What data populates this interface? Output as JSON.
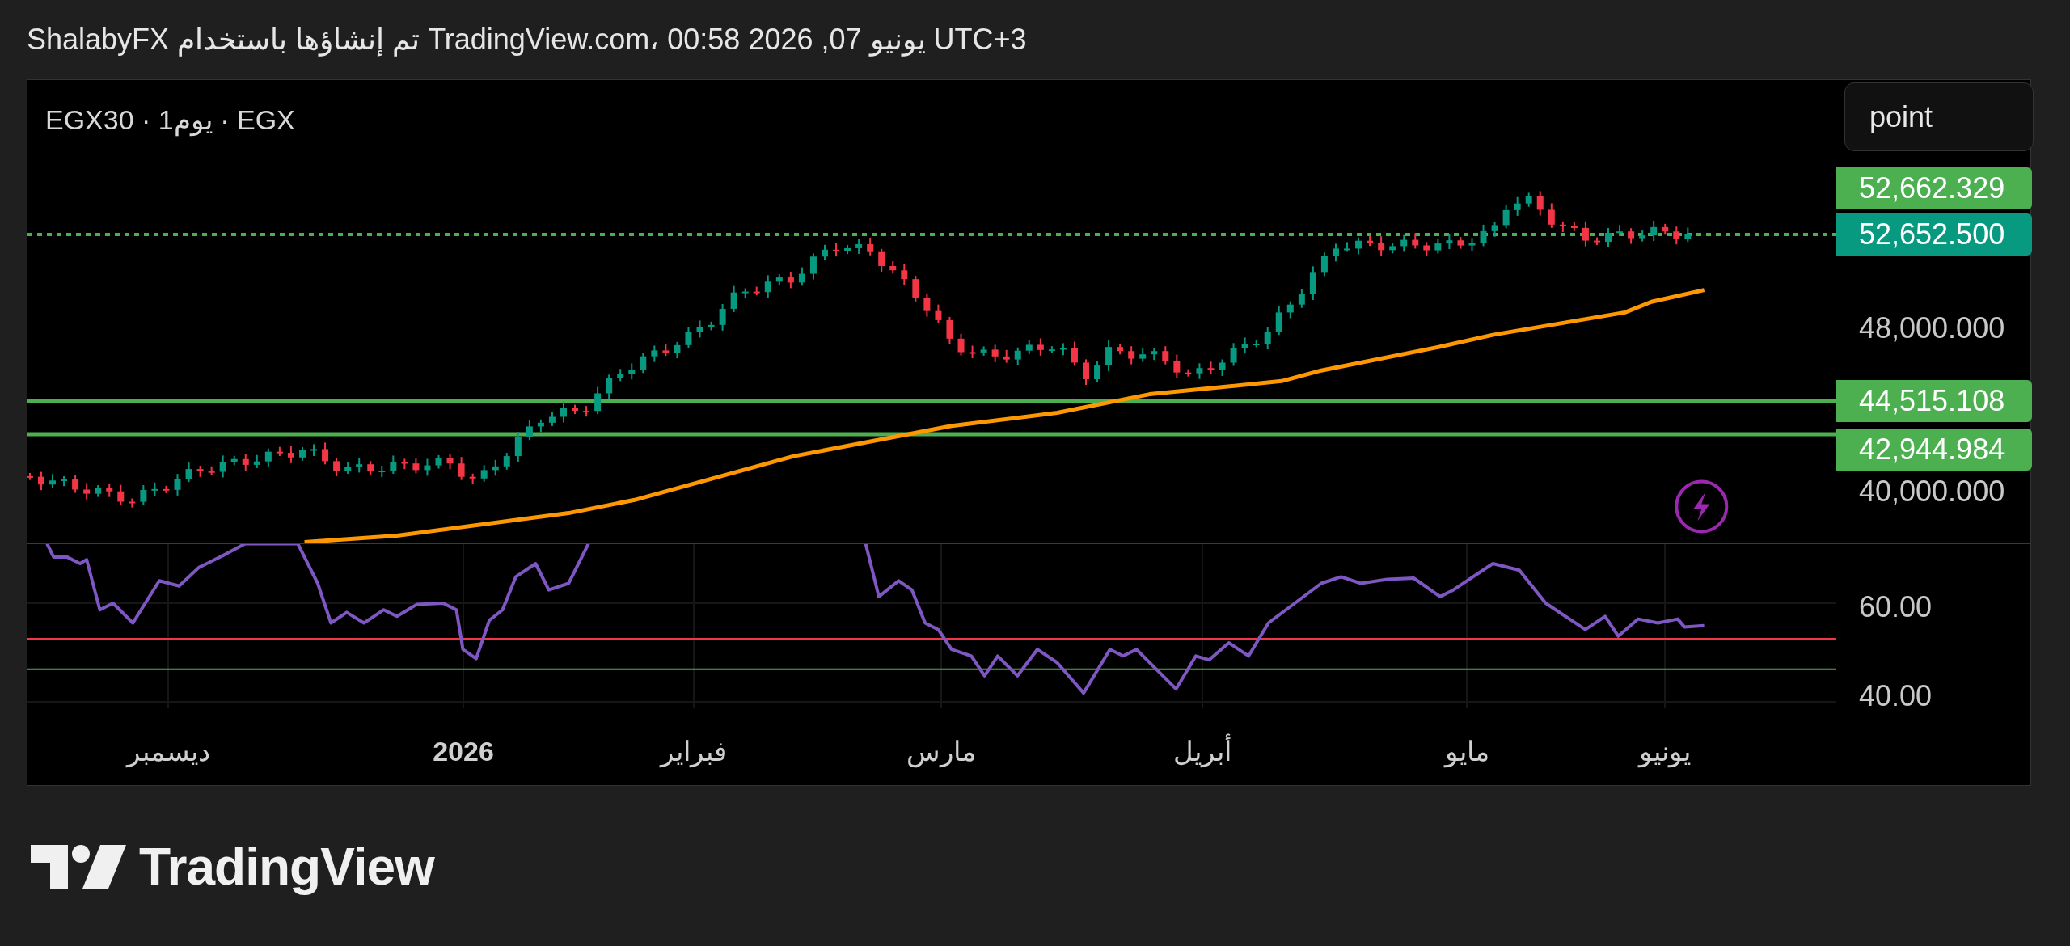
{
  "header": {
    "text": "ShalabyFX تم إنشاؤها باستخدام TradingView.com، يونيو 07, 2026 00:58 UTC+3"
  },
  "legend": {
    "text": "EGX30 · 1يوم · EGX"
  },
  "unit_selector": {
    "label": "point"
  },
  "price_axis": {
    "labels": [
      {
        "text": "52,662.329",
        "kind": "level"
      },
      {
        "text": "52,652.500",
        "kind": "last"
      },
      {
        "text": "48,000.000",
        "kind": "tick"
      },
      {
        "text": "44,515.108",
        "kind": "level"
      },
      {
        "text": "42,944.984",
        "kind": "level"
      },
      {
        "text": "40,000.000",
        "kind": "tick"
      }
    ]
  },
  "rsi_axis": {
    "labels": [
      "60.00",
      "40.00"
    ]
  },
  "time_axis": {
    "labels": [
      {
        "text": "يونيو",
        "kind": "month"
      },
      {
        "text": "مايو",
        "kind": "month"
      },
      {
        "text": "أبريل",
        "kind": "month"
      },
      {
        "text": "مارس",
        "kind": "month"
      },
      {
        "text": "فبراير",
        "kind": "month"
      },
      {
        "text": "2026",
        "kind": "year"
      },
      {
        "text": "ديسمبر",
        "kind": "month"
      }
    ]
  },
  "footer": {
    "logo_text": "TradingView"
  }
}
